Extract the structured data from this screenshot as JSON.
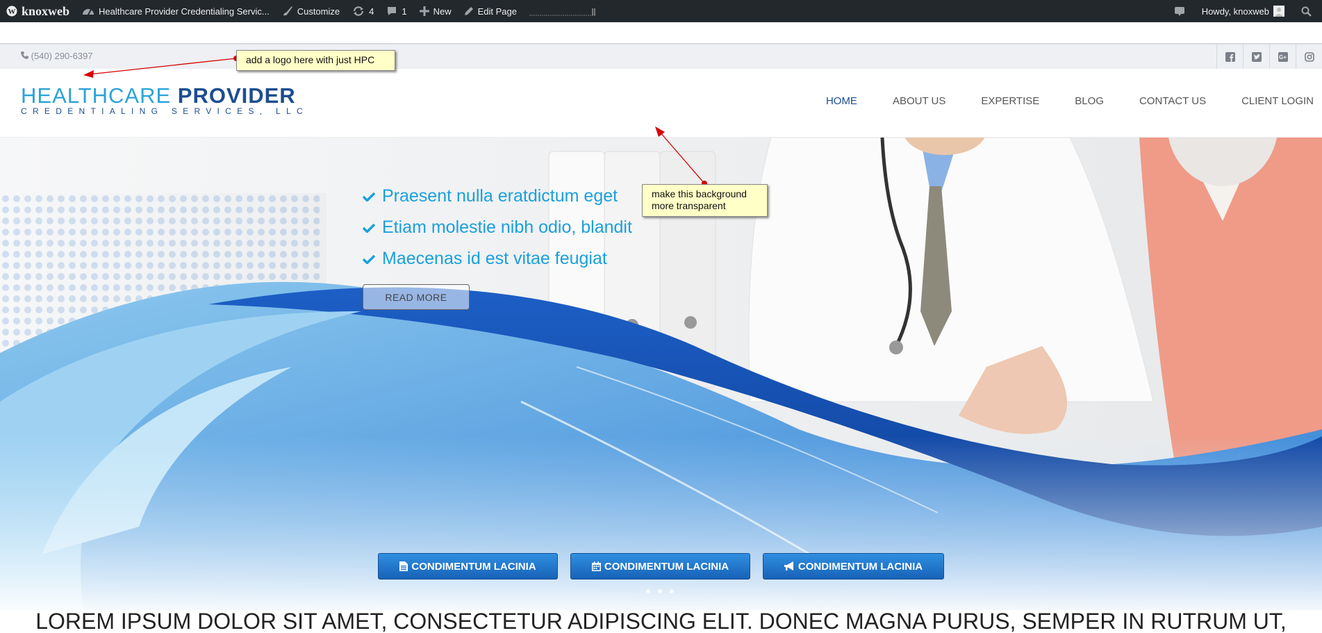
{
  "admin_bar": {
    "brand": "knoxweb",
    "site_name": "Healthcare Provider Credentialing Servic...",
    "customize": "Customize",
    "updates_count": "4",
    "comments_count": "1",
    "new_label": "New",
    "edit_page": "Edit Page",
    "howdy": "Howdy, knoxweb"
  },
  "topbar": {
    "phone": "(540) 290-6397",
    "socials": [
      "facebook-icon",
      "twitter-icon",
      "google-plus-icon",
      "instagram-icon"
    ]
  },
  "logo": {
    "word1": "HEALTHCARE",
    "word2": "PROVIDER",
    "tagline": "CREDENTIALING SERVICES, LLC"
  },
  "nav": {
    "items": [
      "HOME",
      "ABOUT US",
      "EXPERTISE",
      "BLOG",
      "CONTACT US",
      "CLIENT LOGIN"
    ],
    "active": "HOME"
  },
  "hero": {
    "bullets": [
      "Praesent nulla eratdictum eget",
      "Etiam molestie nibh odio, blandit",
      "Maecenas id est vitae feugiat"
    ],
    "read_more": "READ MORE",
    "cta_buttons": [
      "CONDIMENTUM LACINIA",
      "CONDIMENTUM LACINIA",
      "CONDIMENTUM LACINIA"
    ],
    "slide_count": 3
  },
  "lorem": "LOREM IPSUM DOLOR SIT AMET, CONSECTETUR ADIPISCING ELIT. DONEC MAGNA PURUS, SEMPER IN RUTRUM UT,",
  "annotations": {
    "logo_note": "add a logo here with just HPC",
    "background_note_line1": "make this background",
    "background_note_line2": "more transparent"
  },
  "colors": {
    "admin_bar": "#23282d",
    "accent_light_blue": "#1aa0dc",
    "brand_dark_blue": "#1d4d90",
    "cta_blue": "#1f74c8",
    "note_yellow": "#ffffc8",
    "arrow_red": "#d40000"
  }
}
